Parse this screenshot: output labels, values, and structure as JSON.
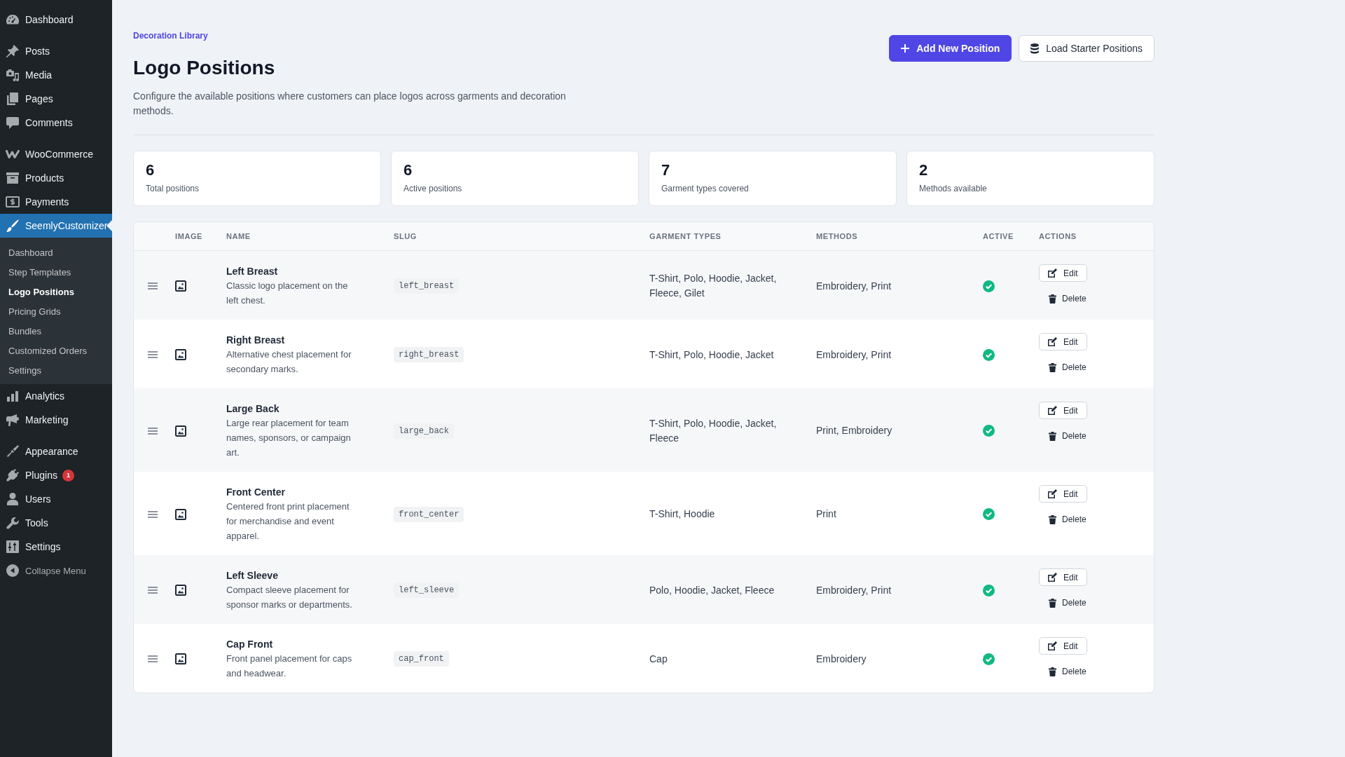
{
  "sidebar": {
    "groups": [
      [
        {
          "label": "Dashboard",
          "selected": false
        }
      ],
      [
        {
          "label": "Posts",
          "selected": false
        },
        {
          "label": "Media",
          "selected": false
        },
        {
          "label": "Pages",
          "selected": false
        },
        {
          "label": "Comments",
          "selected": false
        }
      ],
      [
        {
          "label": "WooCommerce",
          "selected": false
        },
        {
          "label": "Products",
          "selected": false
        },
        {
          "label": "Payments",
          "selected": false
        },
        {
          "label": "SeemlyCustomizer",
          "selected": true,
          "submenu": [
            {
              "label": "Dashboard",
              "selected": false
            },
            {
              "label": "Step Templates",
              "selected": false
            },
            {
              "label": "Logo Positions",
              "selected": true
            },
            {
              "label": "Pricing Grids",
              "selected": false
            },
            {
              "label": "Bundles",
              "selected": false
            },
            {
              "label": "Customized Orders",
              "selected": false
            },
            {
              "label": "Settings",
              "selected": false
            }
          ]
        },
        {
          "label": "Analytics",
          "selected": false
        },
        {
          "label": "Marketing",
          "selected": false
        }
      ],
      [
        {
          "label": "Appearance",
          "selected": false
        },
        {
          "label": "Plugins",
          "selected": false,
          "badge": "1"
        },
        {
          "label": "Users",
          "selected": false
        },
        {
          "label": "Tools",
          "selected": false
        },
        {
          "label": "Settings",
          "selected": false
        }
      ]
    ],
    "collapse": {
      "label": "Collapse Menu"
    }
  },
  "header": {
    "breadcrumb": "Decoration Library",
    "title": "Logo Positions",
    "description": "Configure the available positions where customers can place logos across garments and decoration methods.",
    "buttons": [
      {
        "label": "Add New Position",
        "kind": "primary"
      },
      {
        "label": "Load Starter Positions",
        "kind": "secondary"
      }
    ]
  },
  "stats": [
    {
      "value": "6",
      "label": "Total positions"
    },
    {
      "value": "6",
      "label": "Active positions"
    },
    {
      "value": "7",
      "label": "Garment types covered"
    },
    {
      "value": "2",
      "label": "Methods available"
    }
  ],
  "table": {
    "columns": [
      "IMAGE",
      "NAME",
      "SLUG",
      "GARMENT TYPES",
      "METHODS",
      "ACTIVE",
      "ACTIONS"
    ],
    "rows": [
      {
        "name": "Left Breast",
        "description": "Classic logo placement on the left chest.",
        "slug": "left_breast",
        "garment_types": "T-Shirt, Polo, Hoodie, Jacket, Fleece, Gilet",
        "methods": "Embroidery, Print",
        "active": true,
        "actions": [
          {
            "label": "Edit",
            "kind": "edit"
          },
          {
            "label": "Delete",
            "kind": "delete"
          }
        ]
      },
      {
        "name": "Right Breast",
        "description": "Alternative chest placement for secondary marks.",
        "slug": "right_breast",
        "garment_types": "T-Shirt, Polo, Hoodie, Jacket",
        "methods": "Embroidery, Print",
        "active": true,
        "actions": [
          {
            "label": "Edit",
            "kind": "edit"
          },
          {
            "label": "Delete",
            "kind": "delete"
          }
        ]
      },
      {
        "name": "Large Back",
        "description": "Large rear placement for team names, sponsors, or campaign art.",
        "slug": "large_back",
        "garment_types": "T-Shirt, Polo, Hoodie, Jacket, Fleece",
        "methods": "Print, Embroidery",
        "active": true,
        "actions": [
          {
            "label": "Edit",
            "kind": "edit"
          },
          {
            "label": "Delete",
            "kind": "delete"
          }
        ]
      },
      {
        "name": "Front Center",
        "description": "Centered front print placement for merchandise and event apparel.",
        "slug": "front_center",
        "garment_types": "T-Shirt, Hoodie",
        "methods": "Print",
        "active": true,
        "actions": [
          {
            "label": "Edit",
            "kind": "edit"
          },
          {
            "label": "Delete",
            "kind": "delete"
          }
        ]
      },
      {
        "name": "Left Sleeve",
        "description": "Compact sleeve placement for sponsor marks or departments.",
        "slug": "left_sleeve",
        "garment_types": "Polo, Hoodie, Jacket, Fleece",
        "methods": "Embroidery, Print",
        "active": true,
        "actions": [
          {
            "label": "Edit",
            "kind": "edit"
          },
          {
            "label": "Delete",
            "kind": "delete"
          }
        ]
      },
      {
        "name": "Cap Front",
        "description": "Front panel placement for caps and headwear.",
        "slug": "cap_front",
        "garment_types": "Cap",
        "methods": "Embroidery",
        "active": true,
        "actions": [
          {
            "label": "Edit",
            "kind": "edit"
          },
          {
            "label": "Delete",
            "kind": "delete"
          }
        ]
      }
    ]
  }
}
